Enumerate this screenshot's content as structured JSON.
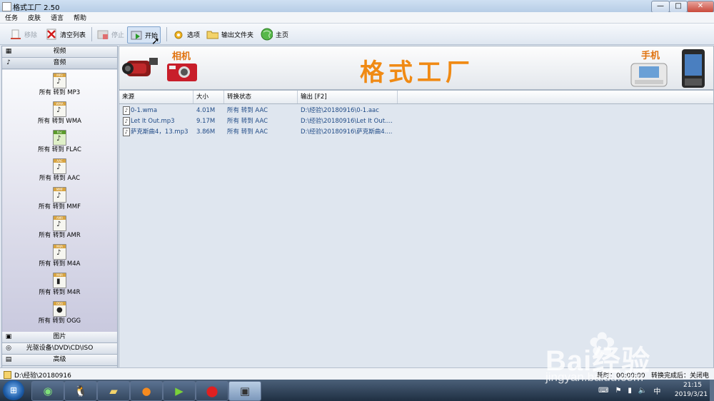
{
  "window": {
    "title": "格式工厂 2.50",
    "minimize": "—",
    "maximize": "□",
    "close": "✕"
  },
  "menu": [
    "任务",
    "皮肤",
    "语言",
    "帮助"
  ],
  "toolbar": {
    "remove": "移除",
    "clear_list": "清空列表",
    "stop": "停止",
    "start": "开始",
    "options": "选项",
    "output_folder": "输出文件夹",
    "home": "主页"
  },
  "sidebar": {
    "categories": {
      "video": "视频",
      "audio": "音频",
      "image": "图片",
      "optical": "光驱设备\\DVD\\CD\\ISO",
      "advanced": "高级"
    },
    "audio_items": [
      {
        "tag": "MP3",
        "label": "所有 转到 MP3"
      },
      {
        "tag": "WMA",
        "label": "所有 转到 WMA"
      },
      {
        "tag": "flac",
        "label": "所有 转到 FLAC"
      },
      {
        "tag": "AAC",
        "label": "所有 转到 AAC"
      },
      {
        "tag": "MMF",
        "label": "所有 转到 MMF"
      },
      {
        "tag": "AMR",
        "label": "所有 转到 AMR"
      },
      {
        "tag": "M4A",
        "label": "所有 转到 M4A"
      },
      {
        "tag": "M4R",
        "label": "所有 转到 M4R"
      },
      {
        "tag": "OGG",
        "label": "所有 转到 OGG"
      }
    ]
  },
  "banner": {
    "title": "格式工厂",
    "camera_label": "相机",
    "phone_label": "手机"
  },
  "table": {
    "headers": {
      "source": "来源",
      "size": "大小",
      "status": "转换状态",
      "output": "输出 [F2]"
    },
    "rows": [
      {
        "source": "0-1.wma",
        "size": "4.01M",
        "status": "所有 转到 AAC",
        "output": "D:\\经验\\20180916\\0-1.aac"
      },
      {
        "source": "Let It Out.mp3",
        "size": "9.17M",
        "status": "所有 转到 AAC",
        "output": "D:\\经验\\20180916\\Let It Out...."
      },
      {
        "source": "萨克斯曲4，13.mp3",
        "size": "3.86M",
        "status": "所有 转到 AAC",
        "output": "D:\\经验\\20180916\\萨克斯曲4...."
      }
    ]
  },
  "statusbar": {
    "path": "D:\\经验\\20180916",
    "elapsed": "耗时：00:00:00",
    "after_done": "转换完成后：关闭电脑"
  },
  "taskbar": {
    "time": "21:15",
    "date": "2019/3/21"
  },
  "watermark": {
    "brand": "Bai经验",
    "url": "jingyan.baidu.com"
  }
}
